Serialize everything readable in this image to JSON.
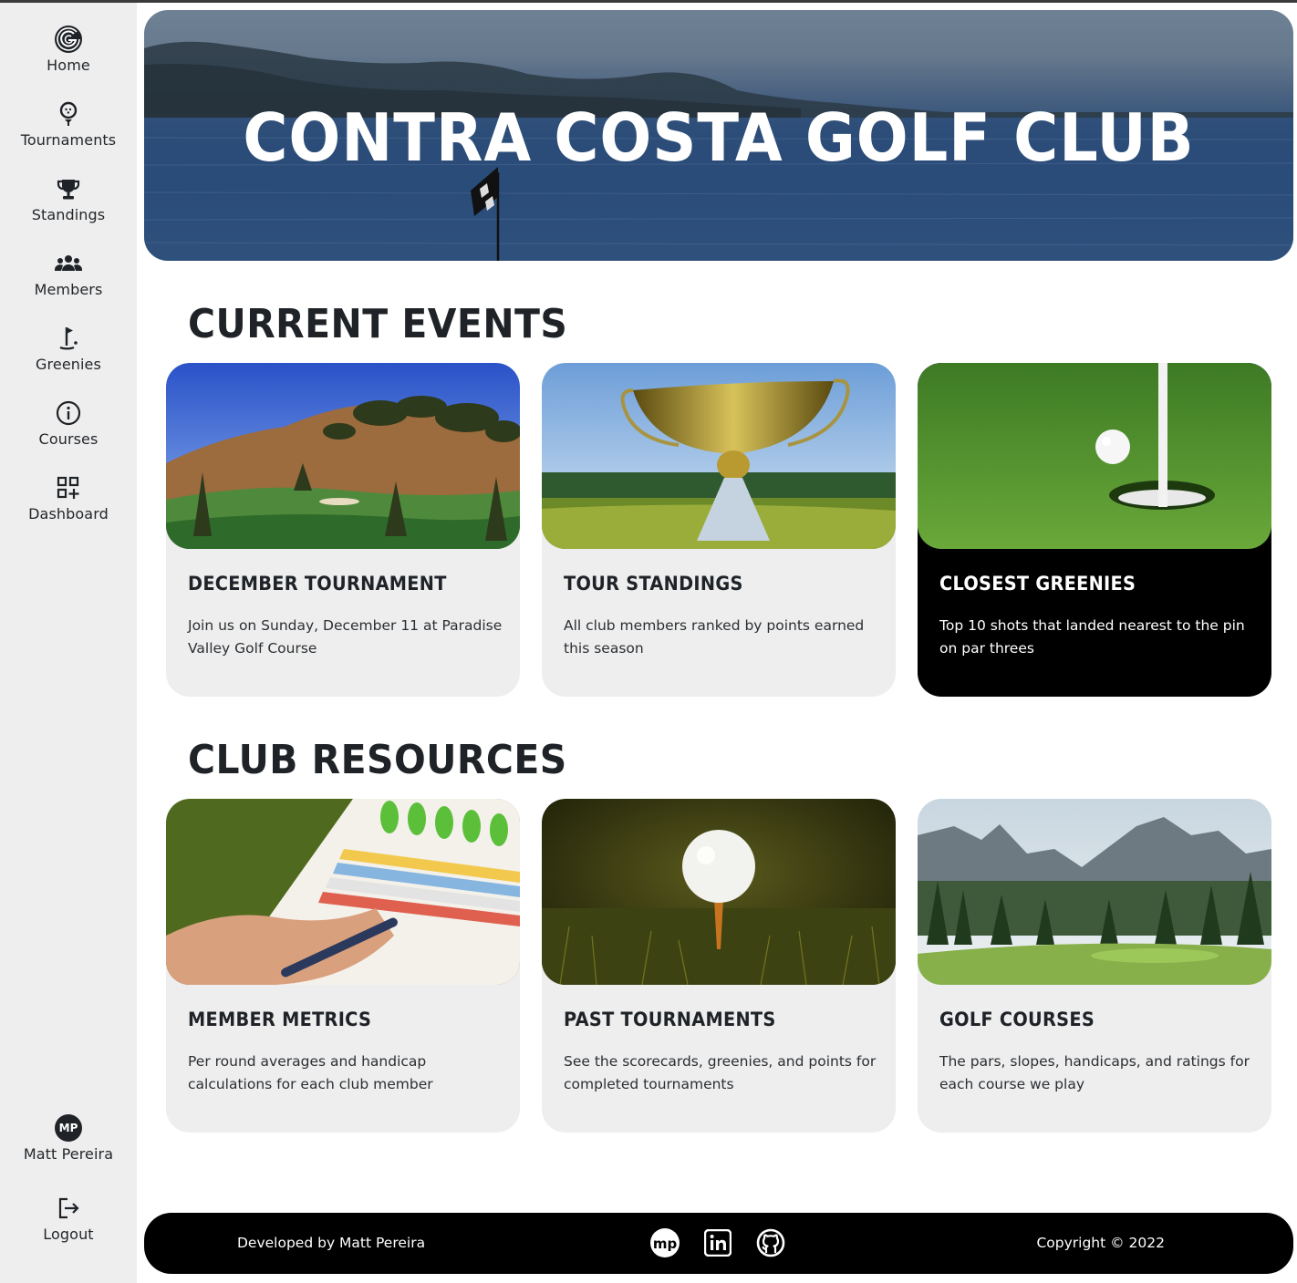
{
  "nav": {
    "items": [
      {
        "label": "Home",
        "icon": "home-logo-icon"
      },
      {
        "label": "Tournaments",
        "icon": "golf-tee-icon"
      },
      {
        "label": "Standings",
        "icon": "trophy-icon"
      },
      {
        "label": "Members",
        "icon": "people-icon"
      },
      {
        "label": "Greenies",
        "icon": "flag-hole-icon"
      },
      {
        "label": "Courses",
        "icon": "info-icon"
      },
      {
        "label": "Dashboard",
        "icon": "dashboard-icon"
      }
    ],
    "user": {
      "initials": "MP",
      "name": "Matt Pereira"
    },
    "logout_label": "Logout"
  },
  "hero": {
    "title": "CONTRA COSTA GOLF CLUB"
  },
  "current_events": {
    "title": "CURRENT EVENTS",
    "cards": [
      {
        "title": "DECEMBER TOURNAMENT",
        "description": "Join us on Sunday, December 11 at Paradise Valley Golf Course"
      },
      {
        "title": "TOUR STANDINGS",
        "description": "All club members ranked by points earned this season"
      },
      {
        "title": "CLOSEST GREENIES",
        "description": "Top 10 shots that landed nearest to the pin on par threes"
      }
    ]
  },
  "club_resources": {
    "title": "CLUB RESOURCES",
    "cards": [
      {
        "title": "MEMBER METRICS",
        "description": "Per round averages and handicap calculations for each club member"
      },
      {
        "title": "PAST TOURNAMENTS",
        "description": "See the scorecards, greenies, and points for completed tournaments"
      },
      {
        "title": "GOLF COURSES",
        "description": "The pars, slopes, handicaps, and ratings for each course we play"
      }
    ]
  },
  "footer": {
    "developed_by": "Developed by  Matt Pereira",
    "copyright": "Copyright © 2022",
    "social": [
      "mp-logo-icon",
      "linkedin-icon",
      "github-icon"
    ]
  },
  "colors": {
    "sidebar": "#eeeeee",
    "card": "#eeeeee",
    "dark_card": "#000000",
    "text": "#1f2328",
    "footer": "#000000"
  }
}
